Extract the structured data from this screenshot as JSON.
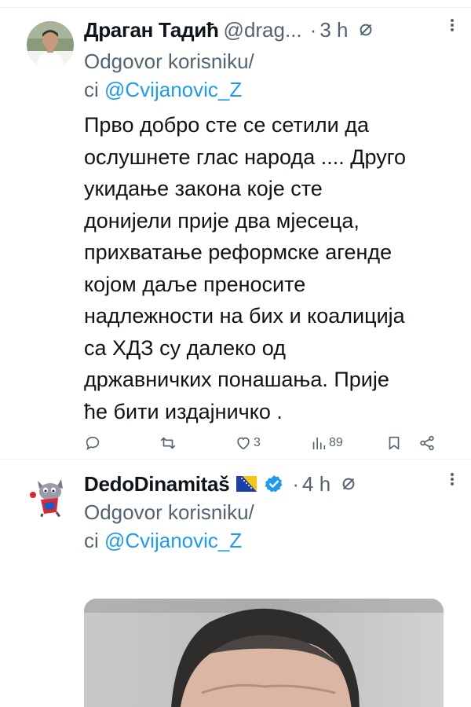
{
  "tweets": [
    {
      "display_name": "Драган Тадић",
      "handle": "@drag...",
      "dot": "·",
      "time": "3 h",
      "reply_prefix": "Odgovor korisniku/",
      "reply_prefix2": "ci",
      "reply_mention": "@Cvijanovic_Z",
      "lines": [
        "Прво добро сте се сетили да",
        "ослушнете глас народа .... Друго",
        "укидање закона које сте",
        "донијели прије два мјесеца,",
        "прихватање реформске агенде",
        "којом даље преносите",
        "надлежности на бих и коалиција",
        "са ХДЗ су далеко од",
        "државничких понашања. Прије",
        "ће бити издајничко ."
      ],
      "actions": {
        "reply_icon": "reply-icon",
        "retweet_icon": "retweet-icon",
        "like_icon": "heart-icon",
        "like_count": "3",
        "views_icon": "views-icon",
        "views_count": "89",
        "bookmark_icon": "bookmark-icon",
        "share_icon": "share-icon"
      }
    },
    {
      "display_name": "DedoDinamitaš",
      "dot": "·",
      "time": "4 h",
      "reply_prefix": "Odgovor korisniku/",
      "reply_prefix2": "ci",
      "reply_mention": "@Cvijanovic_Z"
    }
  ],
  "colors": {
    "text": "#0f1419",
    "muted": "#536471",
    "link": "#1d9bf0",
    "verified": "#1d9bf0"
  }
}
